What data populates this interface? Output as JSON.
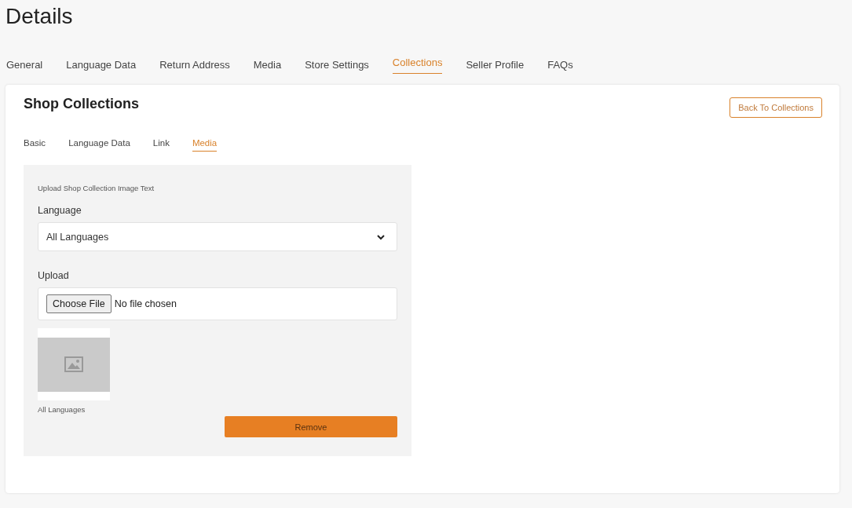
{
  "page_title": "Details",
  "tabs": [
    {
      "label": "General",
      "selected": false
    },
    {
      "label": "Language Data",
      "selected": false
    },
    {
      "label": "Return Address",
      "selected": false
    },
    {
      "label": "Media",
      "selected": false
    },
    {
      "label": "Store Settings",
      "selected": false
    },
    {
      "label": "Collections",
      "selected": true
    },
    {
      "label": "Seller Profile",
      "selected": false
    },
    {
      "label": "FAQs",
      "selected": false
    }
  ],
  "card": {
    "title": "Shop Collections",
    "back_button": "Back To Collections",
    "subtabs": [
      {
        "label": "Basic",
        "selected": false
      },
      {
        "label": "Language Data",
        "selected": false
      },
      {
        "label": "Link",
        "selected": false
      },
      {
        "label": "Media",
        "selected": true
      }
    ],
    "form": {
      "heading": "Upload Shop Collection Image Text",
      "language_label": "Language",
      "language_value": "All Languages",
      "upload_label": "Upload",
      "choose_file": "Choose File",
      "file_status": "No file chosen",
      "thumbnail_caption": "All Languages",
      "remove_button": "Remove"
    }
  }
}
